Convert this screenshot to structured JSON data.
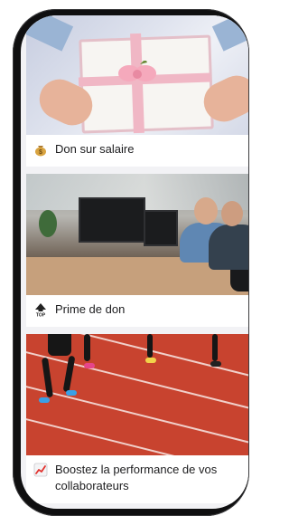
{
  "feed": {
    "items": [
      {
        "emoji": "money-bag-icon",
        "title": "Don sur salaire",
        "image": "gift-box-photo"
      },
      {
        "emoji": "top-arrow-icon",
        "title": "Prime de don",
        "image": "office-team-photo"
      },
      {
        "emoji": "chart-increasing-icon",
        "title": "Boostez la performance de vos collaborateurs",
        "image": "running-track-photo"
      }
    ]
  },
  "colors": {
    "screen_bg": "#f2f2f5",
    "text": "#1c1c1e",
    "track": "#c8432f"
  }
}
